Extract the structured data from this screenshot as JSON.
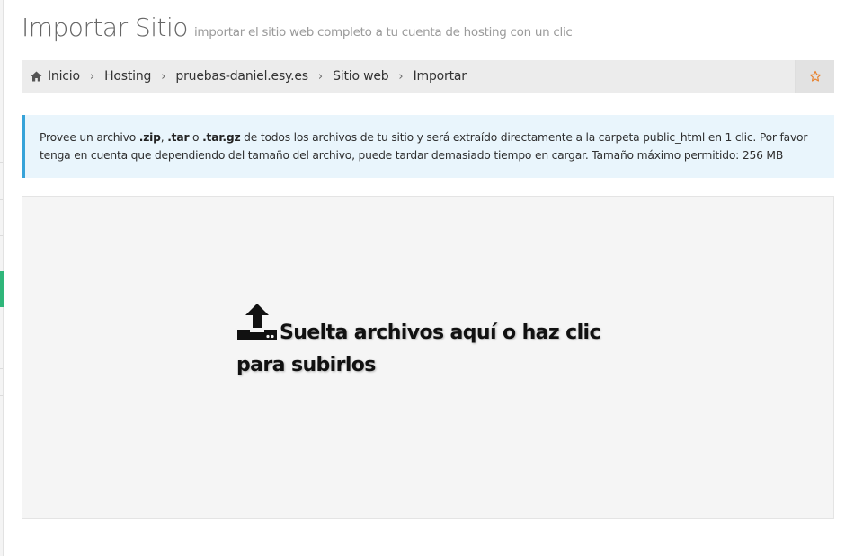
{
  "header": {
    "title": "Importar Sitio",
    "subtitle": "importar el sitio web completo a tu cuenta de hosting con un clic"
  },
  "breadcrumb": {
    "items": [
      {
        "label": "Inicio",
        "icon": "home-icon"
      },
      {
        "label": "Hosting"
      },
      {
        "label": "pruebas-daniel.esy.es"
      },
      {
        "label": "Sitio web"
      },
      {
        "label": "Importar"
      }
    ],
    "separator": "›",
    "favorite_icon": "star-icon"
  },
  "info": {
    "part1": "Provee un archivo ",
    "ext1": ".zip",
    "part2": ", ",
    "ext2": ".tar",
    "part3": " o ",
    "ext3": ".tar.gz",
    "part4": " de todos los archivos de tu sitio y será extraído directamente a la carpeta public_html en 1 clic. Por favor tenga en cuenta que dependiendo del tamaño del archivo, puede tardar demasiado tiempo en cargar. Tamaño máximo permitido: 256 MB"
  },
  "dropzone": {
    "icon": "upload-icon",
    "message": "Suelta archivos aquí o haz clic para subirlos"
  },
  "colors": {
    "accent_green": "#2fb67a",
    "info_border": "#36a3d9",
    "info_bg": "#e9f5fc",
    "star": "#e8812d"
  }
}
